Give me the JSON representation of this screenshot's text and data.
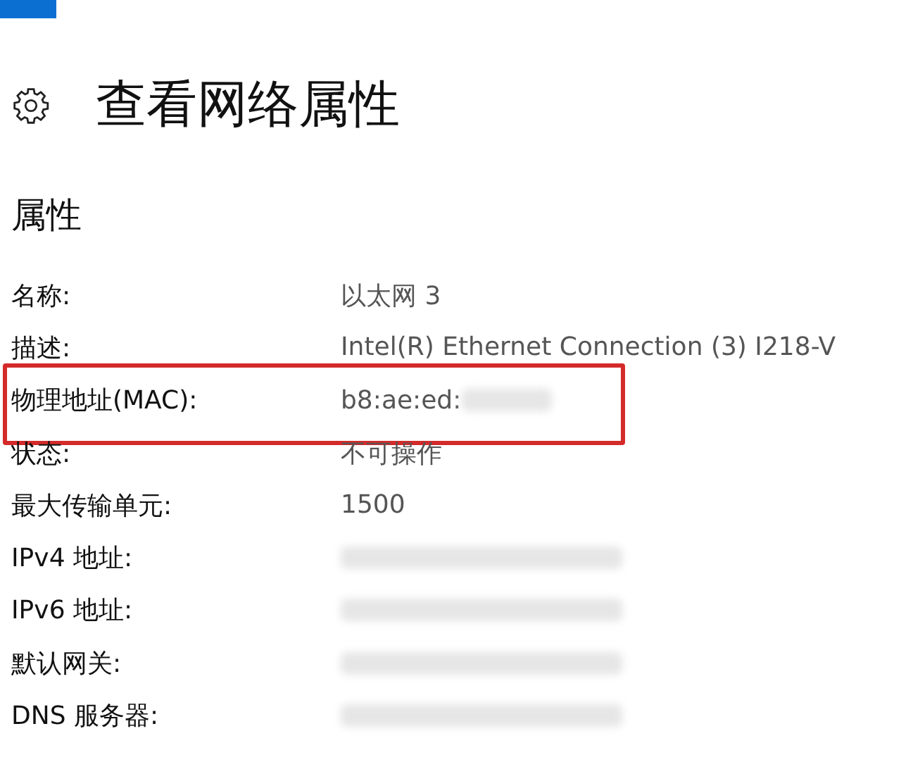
{
  "page": {
    "title": "查看网络属性"
  },
  "section": {
    "title": "属性"
  },
  "properties": [
    {
      "label": "名称:",
      "value": "以太网 3"
    },
    {
      "label": "描述:",
      "value": "Intel(R) Ethernet Connection (3) I218-V"
    },
    {
      "label": "物理地址(MAC):",
      "value": "b8:ae:ed:",
      "redacted": true,
      "highlighted": true
    },
    {
      "label": "状态:",
      "value": "不可操作"
    },
    {
      "label": "最大传输单元:",
      "value": "1500"
    },
    {
      "label": "IPv4 地址:",
      "redacted": true
    },
    {
      "label": "IPv6 地址:",
      "redacted": true
    },
    {
      "label": "默认网关:",
      "redacted": true
    },
    {
      "label": "DNS 服务器:",
      "redacted": true
    }
  ]
}
